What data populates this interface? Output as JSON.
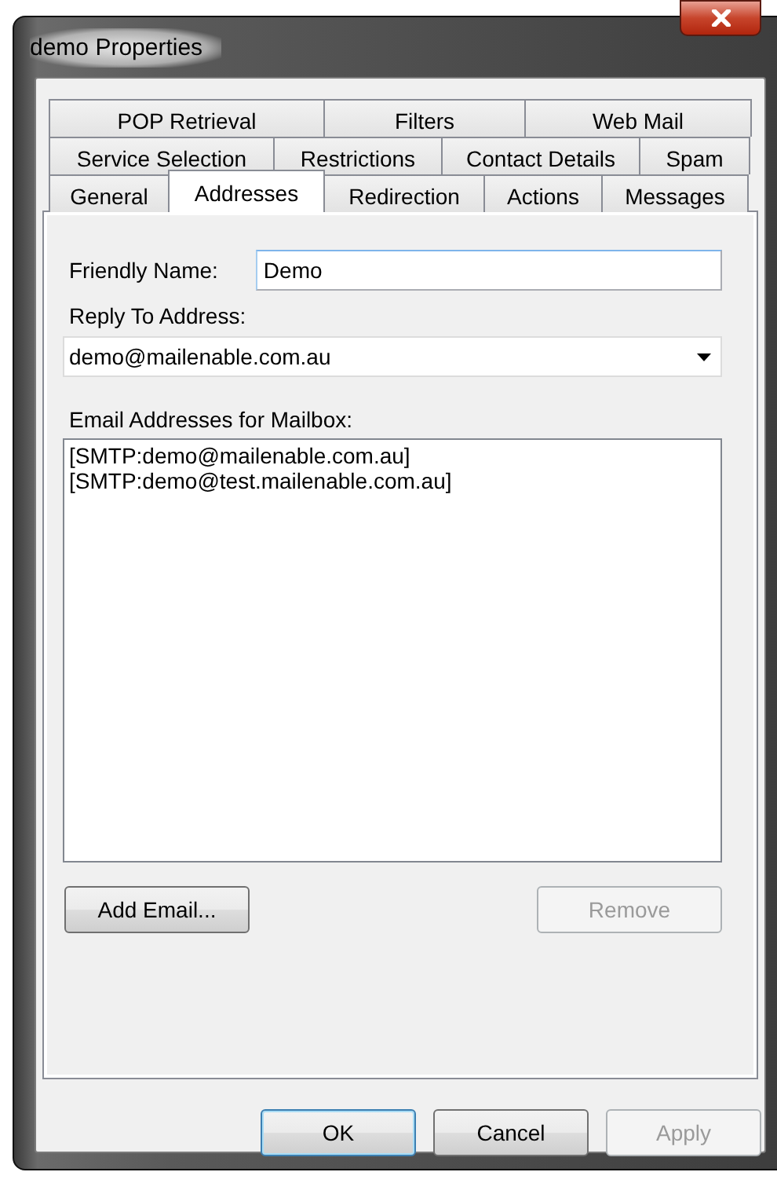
{
  "window": {
    "title": "demo Properties"
  },
  "tab_rows": [
    {
      "tabs": [
        {
          "label": "POP Retrieval",
          "selected": false
        },
        {
          "label": "Filters",
          "selected": false
        },
        {
          "label": "Web Mail",
          "selected": false
        }
      ]
    },
    {
      "tabs": [
        {
          "label": "Service Selection",
          "selected": false
        },
        {
          "label": "Restrictions",
          "selected": false
        },
        {
          "label": "Contact Details",
          "selected": false
        },
        {
          "label": "Spam",
          "selected": false
        }
      ]
    },
    {
      "tabs": [
        {
          "label": "General",
          "selected": false
        },
        {
          "label": "Addresses",
          "selected": true
        },
        {
          "label": "Redirection",
          "selected": false
        },
        {
          "label": "Actions",
          "selected": false
        },
        {
          "label": "Messages",
          "selected": false
        }
      ]
    }
  ],
  "friendly_name": {
    "label": "Friendly Name:",
    "value": "Demo"
  },
  "reply_to": {
    "label": "Reply To Address:",
    "value": "demo@mailenable.com.au"
  },
  "addresses": {
    "label": "Email Addresses for Mailbox:",
    "items": [
      "[SMTP:demo@mailenable.com.au]",
      "[SMTP:demo@test.mailenable.com.au]"
    ]
  },
  "page_buttons": [
    {
      "label": "Add Email...",
      "disabled": false
    },
    {
      "label": "Remove",
      "disabled": true
    }
  ],
  "buttons": [
    {
      "label": "OK",
      "disabled": false,
      "default": true
    },
    {
      "label": "Cancel",
      "disabled": false,
      "default": false
    },
    {
      "label": "Apply",
      "disabled": true,
      "default": false
    }
  ]
}
